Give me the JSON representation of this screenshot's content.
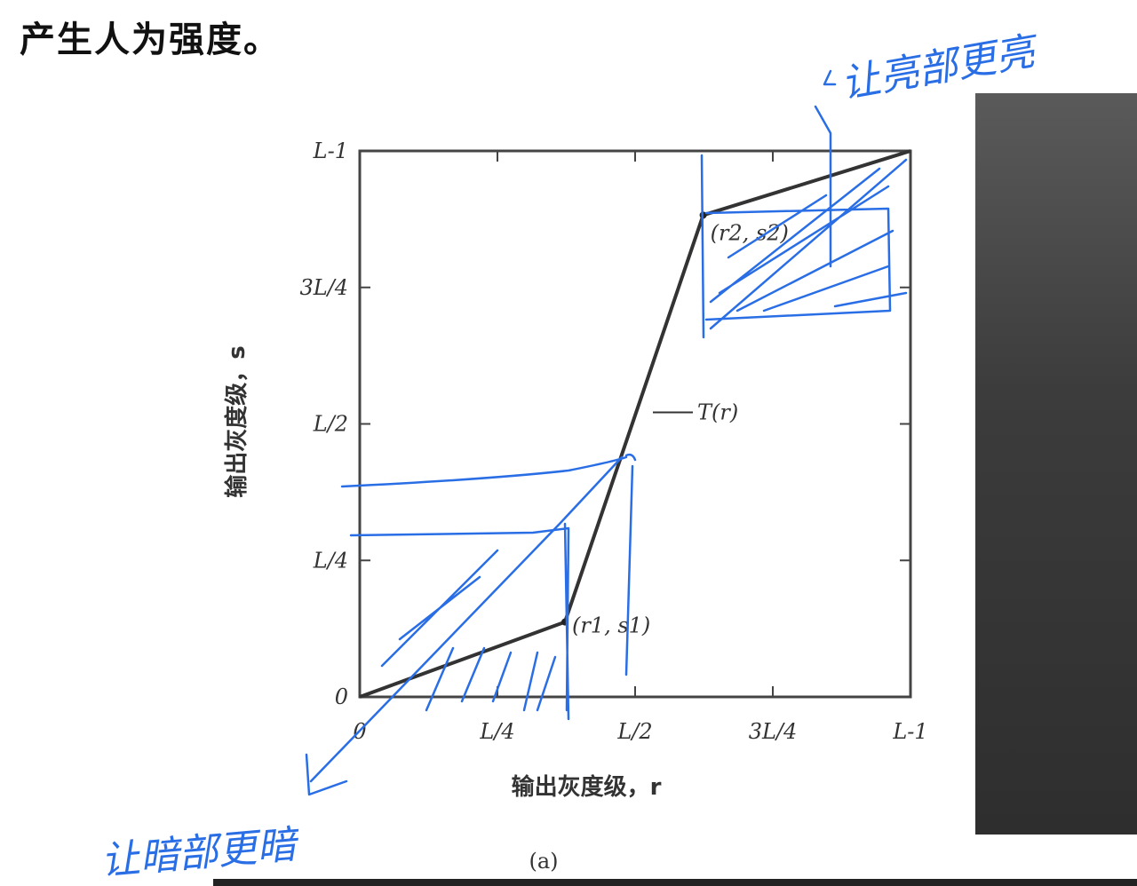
{
  "page": {
    "heading": "产生人为强度。",
    "caption": "(a)"
  },
  "chart_data": {
    "type": "line",
    "title": "",
    "xlabel": "输出灰度级，r",
    "ylabel": "输出灰度级，s",
    "xlim": [
      0,
      255
    ],
    "ylim": [
      0,
      255
    ],
    "ticks": [
      {
        "value": 0,
        "label": "0"
      },
      {
        "value": 63.75,
        "label": "L/4"
      },
      {
        "value": 127.5,
        "label": "L/2"
      },
      {
        "value": 191.25,
        "label": "3L/4"
      },
      {
        "value": 255,
        "label": "L-1"
      }
    ],
    "series": [
      {
        "name": "T(r)",
        "x": [
          0,
          95,
          159,
          255
        ],
        "y": [
          0,
          35,
          225,
          255
        ]
      }
    ],
    "point_labels": [
      {
        "label": "(r1, s1)",
        "x": 95,
        "y": 35
      },
      {
        "label": "(r2, s2)",
        "x": 159,
        "y": 225
      }
    ],
    "curve_label": "T(r)",
    "grid": false
  },
  "annotations": {
    "top_right": "让亮部更亮",
    "bottom_left": "让暗部更暗"
  }
}
